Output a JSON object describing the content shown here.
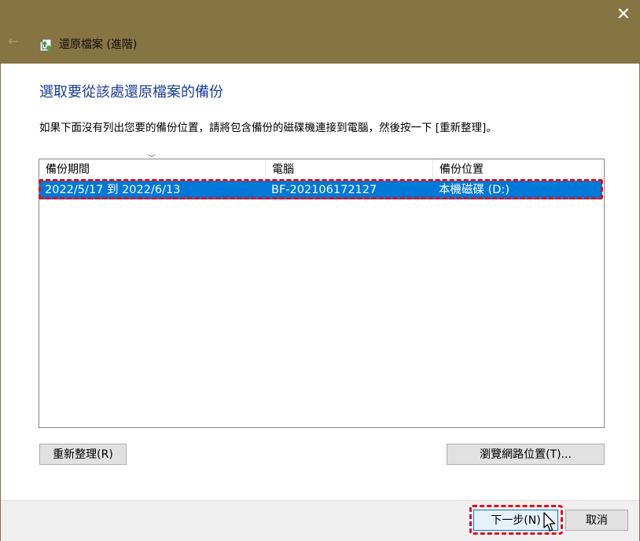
{
  "window": {
    "title": "還原檔案 (進階)",
    "close_glyph": "✕",
    "back_glyph": "←",
    "icons": {
      "back": "back-arrow-icon",
      "app": "restore-files-icon",
      "close": "close-icon",
      "sort": "chevron-down-icon",
      "cursor": "mouse-pointer-icon"
    }
  },
  "main": {
    "heading": "選取要從該處還原檔案的備份",
    "instruction": "如果下面沒有列出您要的備份位置，請將包含備份的磁碟機連接到電腦，然後按一下 [重新整理]。"
  },
  "table": {
    "columns": [
      "備份期間",
      "電腦",
      "備份位置"
    ],
    "sort_glyph": "﹀",
    "rows": [
      {
        "period": "2022/5/17 到 2022/6/13",
        "computer": "BF-202106172127",
        "location": "本機磁碟 (D:)",
        "selected": true
      }
    ]
  },
  "buttons": {
    "refresh": "重新整理(R)",
    "browse": "瀏覽網路位置(T)...",
    "next": "下一步(N)",
    "cancel": "取消"
  },
  "colors": {
    "titlebar": "#877443",
    "selection": "#0078d7",
    "heading": "#1a3d99",
    "annotation": "#e0101a"
  }
}
